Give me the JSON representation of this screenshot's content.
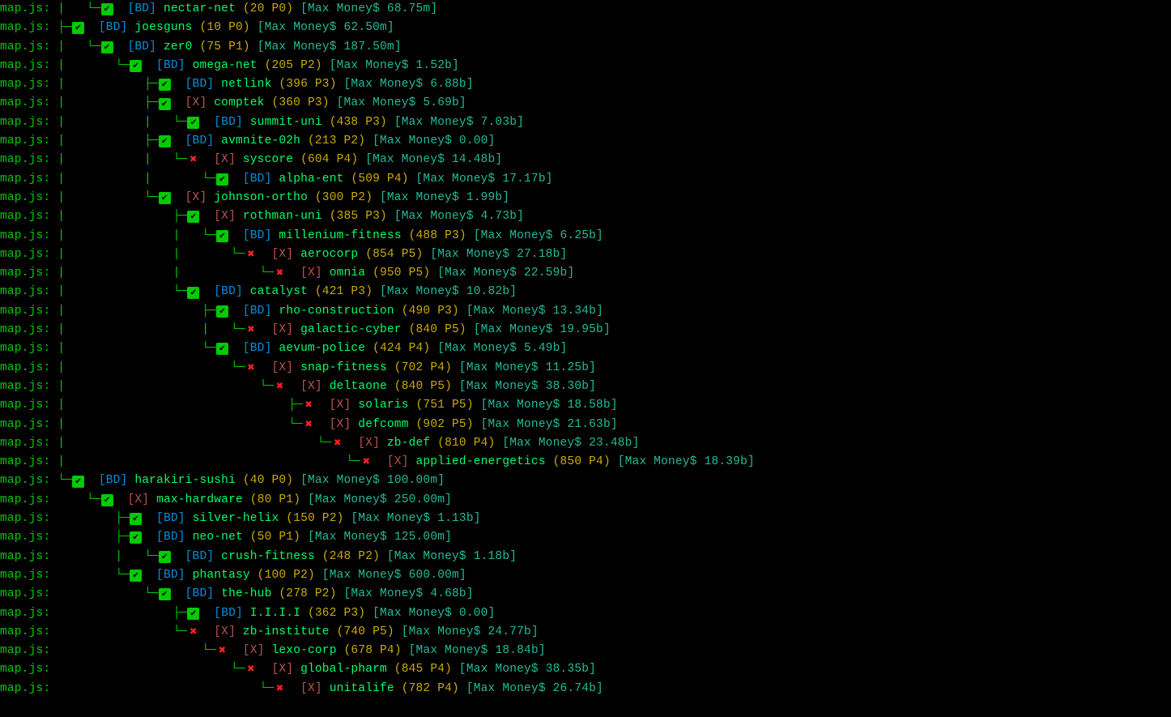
{
  "prefix": "map.js: ",
  "rows": [
    {
      "tree": "|   └─",
      "status": "check",
      "tag": "BD",
      "name": "nectar-net",
      "level": 20,
      "ports": 0,
      "money": "68.75m"
    },
    {
      "tree": "├─",
      "status": "check",
      "tag": "BD",
      "name": "joesguns",
      "level": 10,
      "ports": 0,
      "money": "62.50m"
    },
    {
      "tree": "|   └─",
      "status": "check",
      "tag": "BD",
      "name": "zer0",
      "level": 75,
      "ports": 1,
      "money": "187.50m"
    },
    {
      "tree": "|       └─",
      "status": "check",
      "tag": "BD",
      "name": "omega-net",
      "level": 205,
      "ports": 2,
      "money": "1.52b"
    },
    {
      "tree": "|           ├─",
      "status": "check",
      "tag": "BD",
      "name": "netlink",
      "level": 396,
      "ports": 3,
      "money": "6.88b"
    },
    {
      "tree": "|           ├─",
      "status": "check",
      "tag": "X",
      "name": "comptek",
      "level": 360,
      "ports": 3,
      "money": "5.69b"
    },
    {
      "tree": "|           |   └─",
      "status": "check",
      "tag": "BD",
      "name": "summit-uni",
      "level": 438,
      "ports": 3,
      "money": "7.03b"
    },
    {
      "tree": "|           ├─",
      "status": "check",
      "tag": "BD",
      "name": "avmnite-02h",
      "level": 213,
      "ports": 2,
      "money": "0.00"
    },
    {
      "tree": "|           |   └─",
      "status": "x",
      "tag": "X",
      "name": "syscore",
      "level": 604,
      "ports": 4,
      "money": "14.48b"
    },
    {
      "tree": "|           |       └─",
      "status": "check",
      "tag": "BD",
      "name": "alpha-ent",
      "level": 509,
      "ports": 4,
      "money": "17.17b"
    },
    {
      "tree": "|           └─",
      "status": "check",
      "tag": "X",
      "name": "johnson-ortho",
      "level": 300,
      "ports": 2,
      "money": "1.99b"
    },
    {
      "tree": "|               ├─",
      "status": "check",
      "tag": "X",
      "name": "rothman-uni",
      "level": 385,
      "ports": 3,
      "money": "4.73b"
    },
    {
      "tree": "|               |   └─",
      "status": "check",
      "tag": "BD",
      "name": "millenium-fitness",
      "level": 488,
      "ports": 3,
      "money": "6.25b"
    },
    {
      "tree": "|               |       └─",
      "status": "x",
      "tag": "X",
      "name": "aerocorp",
      "level": 854,
      "ports": 5,
      "money": "27.18b"
    },
    {
      "tree": "|               |           └─",
      "status": "x",
      "tag": "X",
      "name": "omnia",
      "level": 950,
      "ports": 5,
      "money": "22.59b"
    },
    {
      "tree": "|               └─",
      "status": "check",
      "tag": "BD",
      "name": "catalyst",
      "level": 421,
      "ports": 3,
      "money": "10.82b"
    },
    {
      "tree": "|                   ├─",
      "status": "check",
      "tag": "BD",
      "name": "rho-construction",
      "level": 490,
      "ports": 3,
      "money": "13.34b"
    },
    {
      "tree": "|                   |   └─",
      "status": "x",
      "tag": "X",
      "name": "galactic-cyber",
      "level": 840,
      "ports": 5,
      "money": "19.95b"
    },
    {
      "tree": "|                   └─",
      "status": "check",
      "tag": "BD",
      "name": "aevum-police",
      "level": 424,
      "ports": 4,
      "money": "5.49b"
    },
    {
      "tree": "|                       └─",
      "status": "x",
      "tag": "X",
      "name": "snap-fitness",
      "level": 702,
      "ports": 4,
      "money": "11.25b"
    },
    {
      "tree": "|                           └─",
      "status": "x",
      "tag": "X",
      "name": "deltaone",
      "level": 840,
      "ports": 5,
      "money": "38.30b"
    },
    {
      "tree": "|                               ├─",
      "status": "x",
      "tag": "X",
      "name": "solaris",
      "level": 751,
      "ports": 5,
      "money": "18.58b"
    },
    {
      "tree": "|                               └─",
      "status": "x",
      "tag": "X",
      "name": "defcomm",
      "level": 902,
      "ports": 5,
      "money": "21.63b"
    },
    {
      "tree": "|                                   └─",
      "status": "x",
      "tag": "X",
      "name": "zb-def",
      "level": 810,
      "ports": 4,
      "money": "23.48b"
    },
    {
      "tree": "|                                       └─",
      "status": "x",
      "tag": "X",
      "name": "applied-energetics",
      "level": 850,
      "ports": 4,
      "money": "18.39b"
    },
    {
      "tree": "└─",
      "status": "check",
      "tag": "BD",
      "name": "harakiri-sushi",
      "level": 40,
      "ports": 0,
      "money": "100.00m"
    },
    {
      "tree": "    └─",
      "status": "check",
      "tag": "X",
      "name": "max-hardware",
      "level": 80,
      "ports": 1,
      "money": "250.00m"
    },
    {
      "tree": "        ├─",
      "status": "check",
      "tag": "BD",
      "name": "silver-helix",
      "level": 150,
      "ports": 2,
      "money": "1.13b"
    },
    {
      "tree": "        ├─",
      "status": "check",
      "tag": "BD",
      "name": "neo-net",
      "level": 50,
      "ports": 1,
      "money": "125.00m"
    },
    {
      "tree": "        |   └─",
      "status": "check",
      "tag": "BD",
      "name": "crush-fitness",
      "level": 248,
      "ports": 2,
      "money": "1.18b"
    },
    {
      "tree": "        └─",
      "status": "check",
      "tag": "BD",
      "name": "phantasy",
      "level": 100,
      "ports": 2,
      "money": "600.00m"
    },
    {
      "tree": "            └─",
      "status": "check",
      "tag": "BD",
      "name": "the-hub",
      "level": 278,
      "ports": 2,
      "money": "4.68b"
    },
    {
      "tree": "                ├─",
      "status": "check",
      "tag": "BD",
      "name": "I.I.I.I",
      "level": 362,
      "ports": 3,
      "money": "0.00"
    },
    {
      "tree": "                └─",
      "status": "x",
      "tag": "X",
      "name": "zb-institute",
      "level": 740,
      "ports": 5,
      "money": "24.77b"
    },
    {
      "tree": "                    └─",
      "status": "x",
      "tag": "X",
      "name": "lexo-corp",
      "level": 678,
      "ports": 4,
      "money": "18.84b"
    },
    {
      "tree": "                        └─",
      "status": "x",
      "tag": "X",
      "name": "global-pharm",
      "level": 845,
      "ports": 4,
      "money": "38.35b"
    },
    {
      "tree": "                            └─",
      "status": "x",
      "tag": "X",
      "name": "unitalife",
      "level": 782,
      "ports": 4,
      "money": "26.74b"
    }
  ]
}
